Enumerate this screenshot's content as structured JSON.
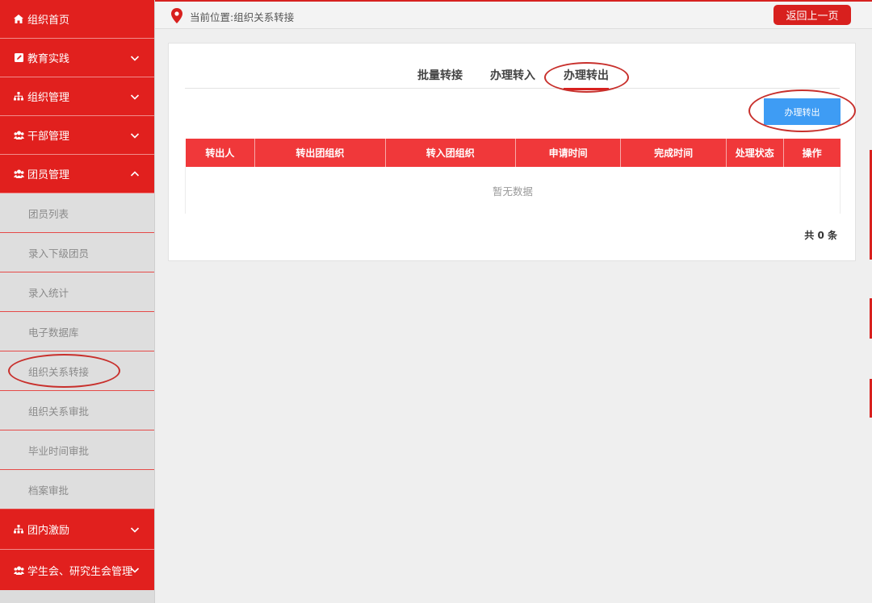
{
  "sidebar": {
    "items": [
      {
        "label": "组织首页",
        "icon": "home-icon",
        "chevron": "none"
      },
      {
        "label": "教育实践",
        "icon": "edit-icon",
        "chevron": "down"
      },
      {
        "label": "组织管理",
        "icon": "sitemap-icon",
        "chevron": "down"
      },
      {
        "label": "干部管理",
        "icon": "users-icon",
        "chevron": "down"
      },
      {
        "label": "团员管理",
        "icon": "users-icon",
        "chevron": "up"
      }
    ],
    "sub_items": [
      {
        "label": "团员列表"
      },
      {
        "label": "录入下级团员"
      },
      {
        "label": "录入统计"
      },
      {
        "label": "电子数据库"
      },
      {
        "label": "组织关系转接"
      },
      {
        "label": "组织关系审批"
      },
      {
        "label": "毕业时间审批"
      },
      {
        "label": "档案审批"
      }
    ],
    "bottom_items": [
      {
        "label": "团内激励",
        "icon": "sitemap-icon",
        "chevron": "down"
      },
      {
        "label": "学生会、研究生会管理",
        "icon": "users-icon",
        "chevron": "down"
      }
    ]
  },
  "topbar": {
    "location_text": "当前位置:组织关系转接",
    "back_button": "返回上一页"
  },
  "tabs": [
    {
      "label": "批量转接",
      "active": false
    },
    {
      "label": "办理转入",
      "active": false
    },
    {
      "label": "办理转出",
      "active": true
    }
  ],
  "action_button": "办理转出",
  "table": {
    "headers": [
      "转出人",
      "转出团组织",
      "转入团组织",
      "申请时间",
      "完成时间",
      "处理状态",
      "操作"
    ],
    "empty_text": "暂无数据"
  },
  "total_text": "共 0 条",
  "colors": {
    "brand_red": "#e1201e",
    "header_red": "#f0383a",
    "button_blue": "#3e9cf4"
  }
}
